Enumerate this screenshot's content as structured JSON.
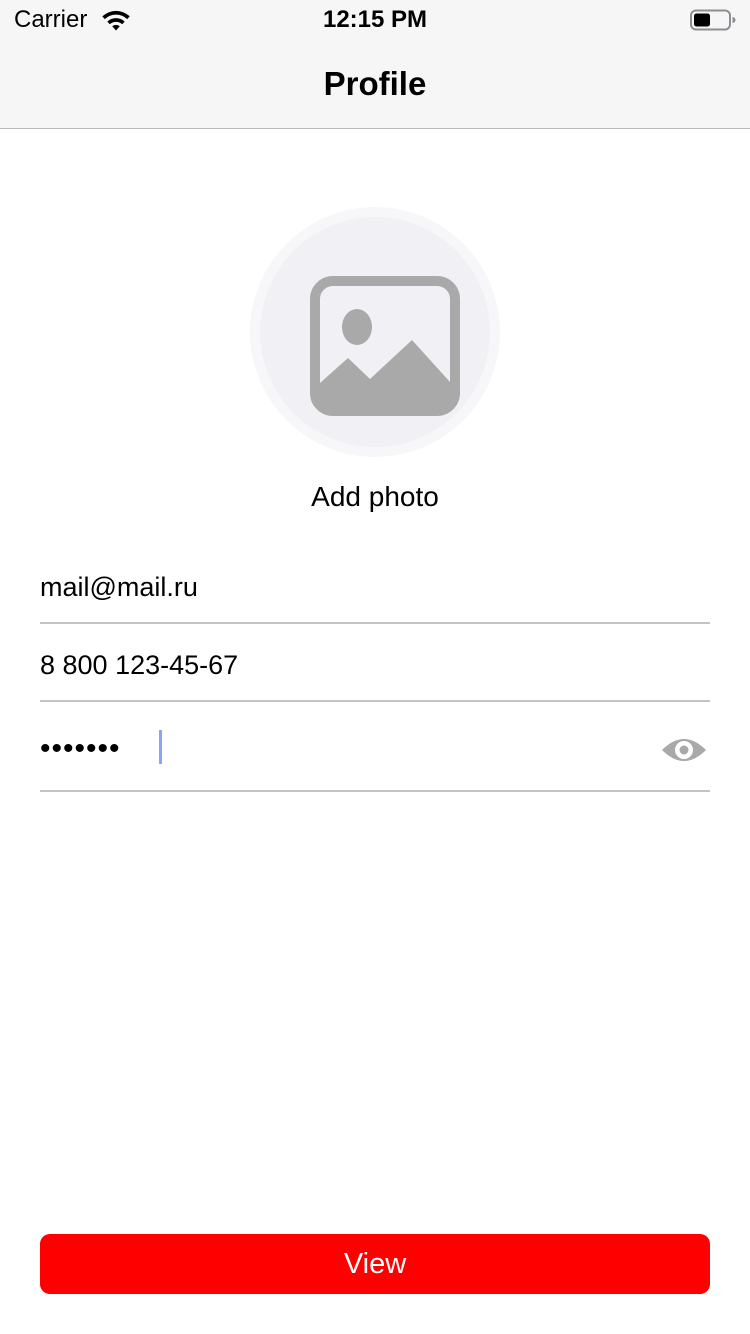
{
  "status_bar": {
    "carrier": "Carrier",
    "time": "12:15 PM",
    "wifi_icon": "wifi-icon",
    "battery_icon": "battery-icon"
  },
  "nav": {
    "title": "Profile"
  },
  "avatar": {
    "icon": "image-placeholder-icon",
    "label": "Add photo"
  },
  "form": {
    "email": {
      "value": "mail@mail.ru"
    },
    "phone": {
      "value": "8 800 123-45-67"
    },
    "password": {
      "masked_value": "•••••••",
      "toggle_icon": "eye-icon"
    }
  },
  "actions": {
    "view_label": "View",
    "view_color": "#ff0000"
  }
}
